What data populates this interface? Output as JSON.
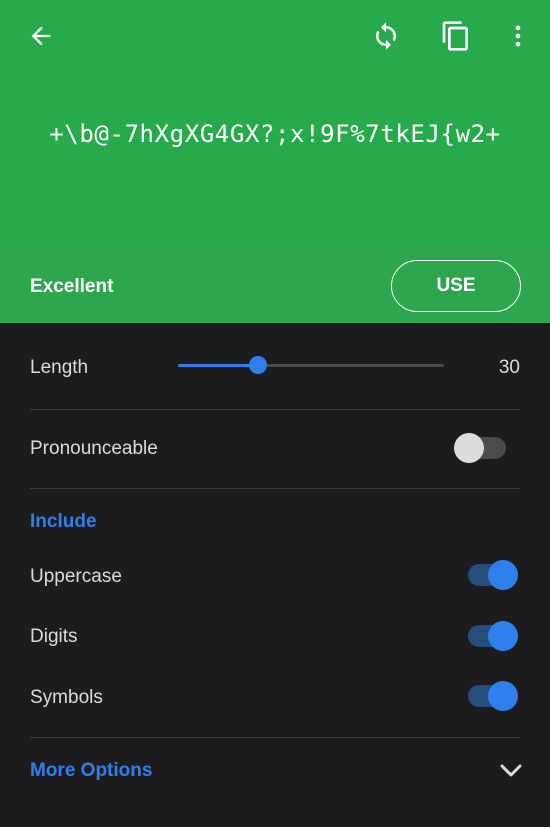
{
  "header": {
    "password": "+\\b@-7hXgXG4GX?;x!9F%7tkEJ{w2+",
    "icons": {
      "back": "arrow-left-icon",
      "refresh": "refresh-icon",
      "copy": "copy-icon",
      "more": "more-vertical-icon"
    },
    "color": "#27aa4b"
  },
  "strength": {
    "label": "Excellent",
    "use_label": "USE"
  },
  "length": {
    "label": "Length",
    "value": "30",
    "fraction": 0.3
  },
  "pronounceable": {
    "label": "Pronounceable",
    "enabled": false
  },
  "include": {
    "title": "Include",
    "items": [
      {
        "label": "Uppercase",
        "enabled": true
      },
      {
        "label": "Digits",
        "enabled": true
      },
      {
        "label": "Symbols",
        "enabled": true
      }
    ]
  },
  "more_options": {
    "label": "More Options"
  },
  "colors": {
    "accent": "#2f80ed",
    "background": "#1c1c1e"
  }
}
